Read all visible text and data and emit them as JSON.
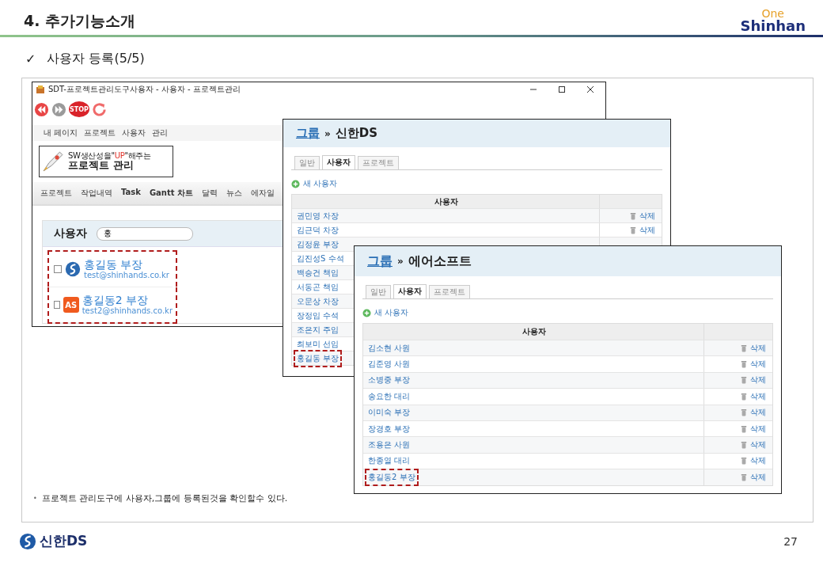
{
  "slide": {
    "title": "4. 추가기능소개",
    "logo_top": "One",
    "logo_bottom": "Shinhan",
    "check_mark": "✓",
    "subtitle": "사용자 등록(5/5)",
    "note_bullet": "•",
    "note": "프로젝트 관리도구에 사용자,그룹에 등록된것을 확인할수 있다.",
    "footer_logo": "신한DS",
    "page_number": "27"
  },
  "app_window": {
    "title": "SDT-프로젝트관리도구사용자 - 사용자 - 프로젝트관리",
    "stop_label": "STOP",
    "top_menu": [
      "내 페이지",
      "프로젝트",
      "사용자",
      "관리"
    ],
    "logo_tagline": {
      "before": "SW생산성을\"",
      "highlight": "UP",
      "after": "\"해주는"
    },
    "logo_title": "프로젝트 관리",
    "nav": [
      "프로젝트",
      "작업내역",
      "Task",
      "Gantt 차트",
      "달력",
      "뉴스",
      "에자일"
    ],
    "panel_title": "사용자",
    "search_value": "홍",
    "users": [
      {
        "name": "홍길동 부장",
        "email": "test@shinhands.co.kr",
        "checked": false,
        "kind": "globe",
        "highlighted": true
      },
      {
        "name": "홍길동2 부장",
        "email": "test2@shinhands.co.kr",
        "checked": false,
        "kind": "letters",
        "avatar_text": "AS",
        "highlighted": true
      }
    ]
  },
  "group_windows": [
    {
      "crumb": "그룹",
      "separator": "»",
      "name": "신한DS",
      "tabs": [
        {
          "label": "일반",
          "selected": false
        },
        {
          "label": "사용자",
          "selected": true
        },
        {
          "label": "프로젝트",
          "selected": false
        }
      ],
      "add_link": "새 사용자",
      "column": "사용자",
      "rows": [
        {
          "name": "권민영 차장",
          "action": "삭제",
          "highlighted": false
        },
        {
          "name": "김근덕 차장",
          "action": "삭제",
          "highlighted": false
        },
        {
          "name": "김정윤 부장",
          "highlighted": false
        },
        {
          "name": "김진성S 수석",
          "highlighted": false
        },
        {
          "name": "백승건 책임",
          "highlighted": false
        },
        {
          "name": "서동곤 책임",
          "highlighted": false
        },
        {
          "name": "오문상 차장",
          "highlighted": false
        },
        {
          "name": "장정임 수석",
          "highlighted": false
        },
        {
          "name": "조은지 주임",
          "highlighted": false
        },
        {
          "name": "최보미 선임",
          "highlighted": false
        },
        {
          "name": "홍길동 부장",
          "highlighted": true
        }
      ]
    },
    {
      "crumb": "그룹",
      "separator": "»",
      "name": "에어소프트",
      "tabs": [
        {
          "label": "일반",
          "selected": false
        },
        {
          "label": "사용자",
          "selected": true
        },
        {
          "label": "프로젝트",
          "selected": false
        }
      ],
      "add_link": "새 사용자",
      "column": "사용자",
      "rows": [
        {
          "name": "김소현 사원",
          "action": "삭제",
          "highlighted": false
        },
        {
          "name": "김준영 사원",
          "action": "삭제",
          "highlighted": false
        },
        {
          "name": "소병중 부장",
          "action": "삭제",
          "highlighted": false
        },
        {
          "name": "송요한 대리",
          "action": "삭제",
          "highlighted": false
        },
        {
          "name": "이미숙 부장",
          "action": "삭제",
          "highlighted": false
        },
        {
          "name": "장경호 부장",
          "action": "삭제",
          "highlighted": false
        },
        {
          "name": "조용은 사원",
          "action": "삭제",
          "highlighted": false
        },
        {
          "name": "한종열 대리",
          "action": "삭제",
          "highlighted": false
        },
        {
          "name": "홍길동2 부장",
          "action": "삭제",
          "highlighted": true
        }
      ]
    }
  ]
}
